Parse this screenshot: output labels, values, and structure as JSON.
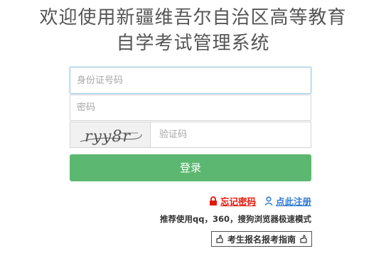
{
  "header": {
    "title_line1": "欢迎使用新疆维吾尔自治区高等教育",
    "title_line2": "自学考试管理系统"
  },
  "form": {
    "id_placeholder": "身份证号码",
    "password_placeholder": "密码",
    "captcha_text": "ryy8r",
    "captcha_placeholder": "验证码",
    "login_label": "登录"
  },
  "links": {
    "forgot_label": "忘记密码",
    "register_label": "点此注册"
  },
  "tip": "推荐使用qq，360，搜狗浏览器极速模式",
  "guide_label": "考生报名报考指南",
  "colors": {
    "login_button": "#5cb870",
    "forgot_link": "#e3170a",
    "register_link": "#2d7ad6",
    "title_text": "#555555"
  },
  "icons": {
    "forgot": "lock-icon",
    "register": "user-icon",
    "guide_left": "pointing-hand-icon",
    "guide_right": "pointing-hand-icon"
  }
}
